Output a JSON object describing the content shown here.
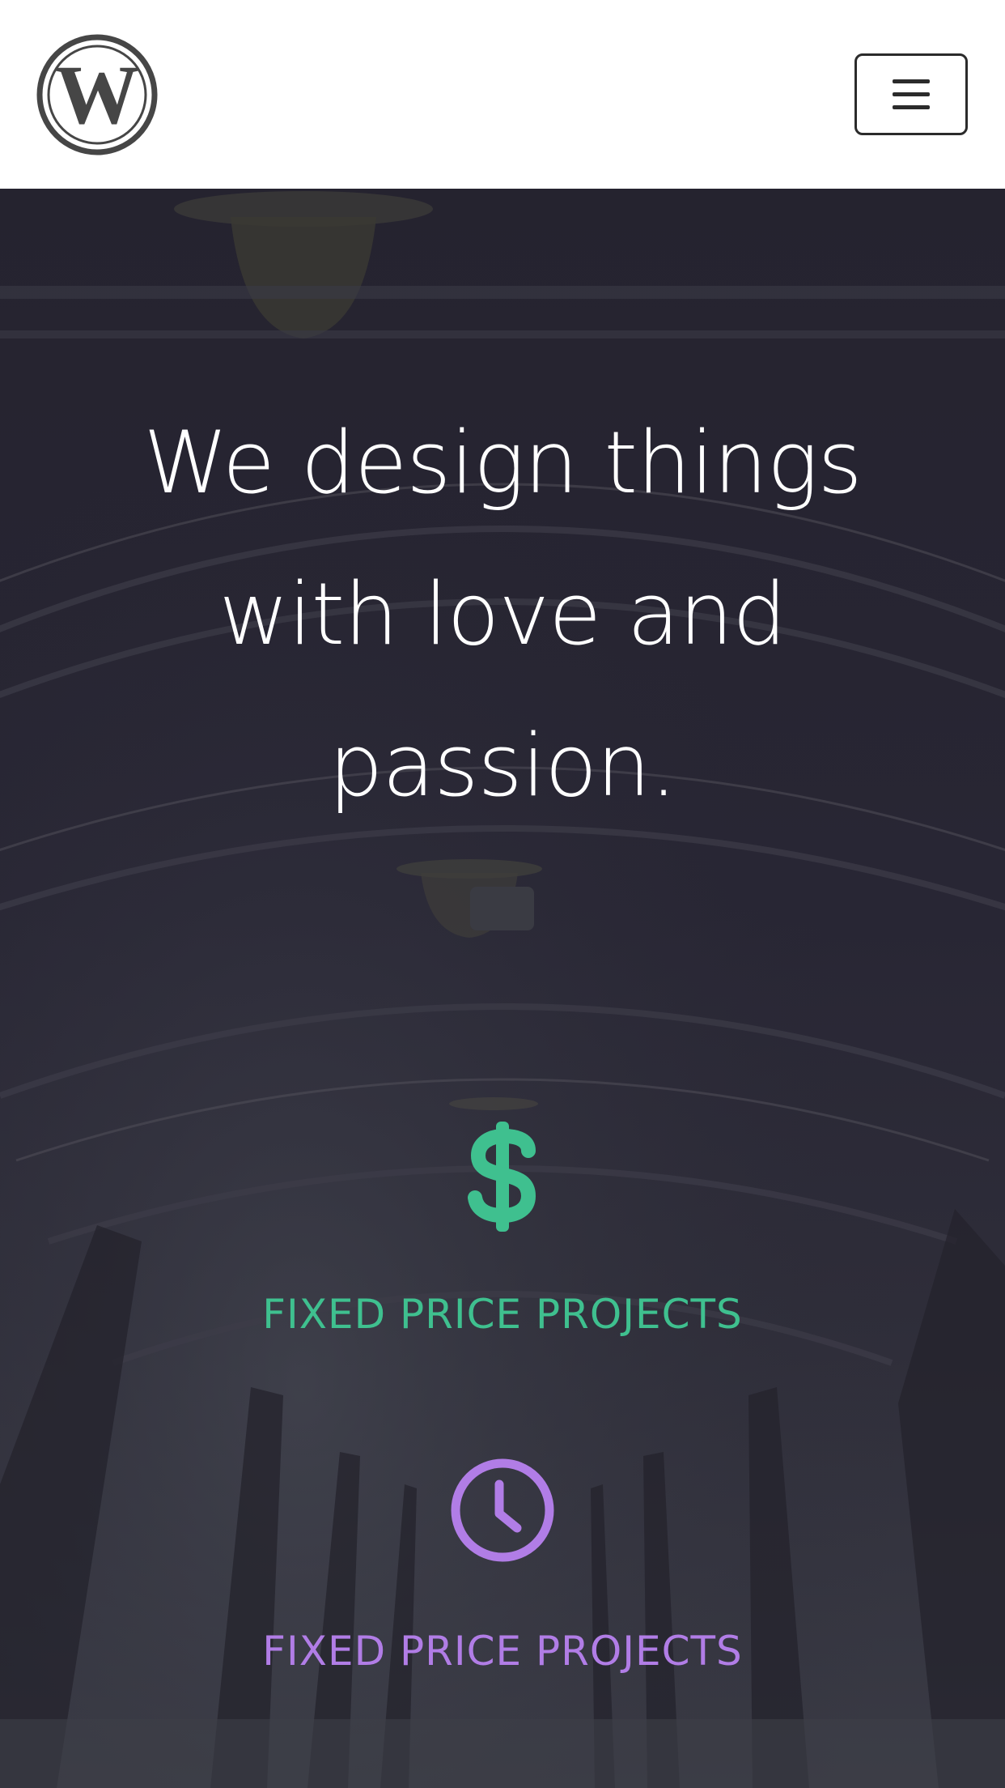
{
  "header": {
    "logo_icon": "wordpress-logo-icon",
    "menu_icon": "hamburger-menu-icon"
  },
  "hero": {
    "headline": "We design things with love and passion."
  },
  "features": [
    {
      "icon": "dollar-icon",
      "label": "FIXED PRICE PROJECTS",
      "color": "#3fc08f"
    },
    {
      "icon": "clock-icon",
      "label": "FIXED PRICE PROJECTS",
      "color": "#b17de6"
    }
  ]
}
